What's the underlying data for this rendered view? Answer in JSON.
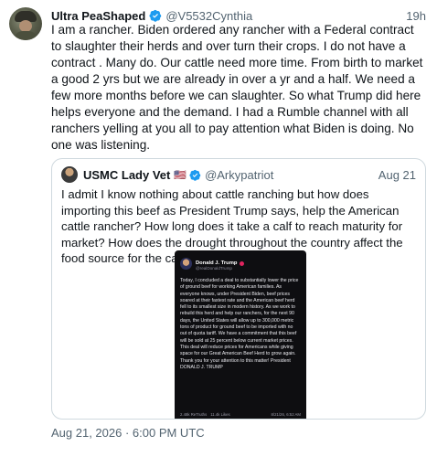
{
  "tweet": {
    "display_name": "Ultra PeaShaped",
    "handle": "@V5532Cynthia",
    "time": "19h",
    "text": "I am a rancher. Biden ordered any rancher with a Federal contract to slaughter their herds and over turn their crops. I do not have a contract . Many do. Our cattle need more time. From birth to market a good 2 yrs but we are already in over a yr and a half. We need a few more months before we can slaughter. So what Trump did here helps everyone and the demand. I had a Rumble channel with all ranchers yelling at you all to pay attention what Biden is doing. No one was listening.",
    "timestamp": "Aug 21, 2026 · 6:00 PM UTC"
  },
  "quote": {
    "display_name": "USMC Lady Vet",
    "flag": "🇺🇸",
    "handle": "@Arkypatriot",
    "time": "Aug 21",
    "text": "I admit I know nothing about cattle ranching but how does importing this beef as President Trump says, help the American cattle rancher?  How long does it take a calf to reach maturity for market?  How does the drought throughout the country affect the food source for the cattle?"
  },
  "embedded_post": {
    "name": "Donald J. Trump",
    "handle": "@realDonaldTrump",
    "text": "Today, I concluded a deal to substantially lower the price of ground beef for working American families. As everyone knows, under President Biden, beef prices soared at their fastest rate and the American beef herd fell to its smallest size in modern history. As we work to rebuild this herd and help our ranchers, for the next 90 days, the United States will allow up to 300,000 metric tons of product for ground beef to be imported with no out of quota tariff. We have a commitment that this beef will be sold at 25 percent below current market prices. This deal will reduce prices for Americans while giving space for our Great American Beef Herd to grow again. Thank you for your attention to this matter! President DONALD J. TRUMP",
    "retruths": "2.48k ReTruths",
    "likes": "11.4k Likes",
    "date": "8/21/26, 6:52 AM"
  },
  "colors": {
    "verified_blue": "#1d9bf0",
    "secondary_text": "#536471",
    "border": "#cfd9de",
    "embedded_bg": "#0e0e11"
  }
}
